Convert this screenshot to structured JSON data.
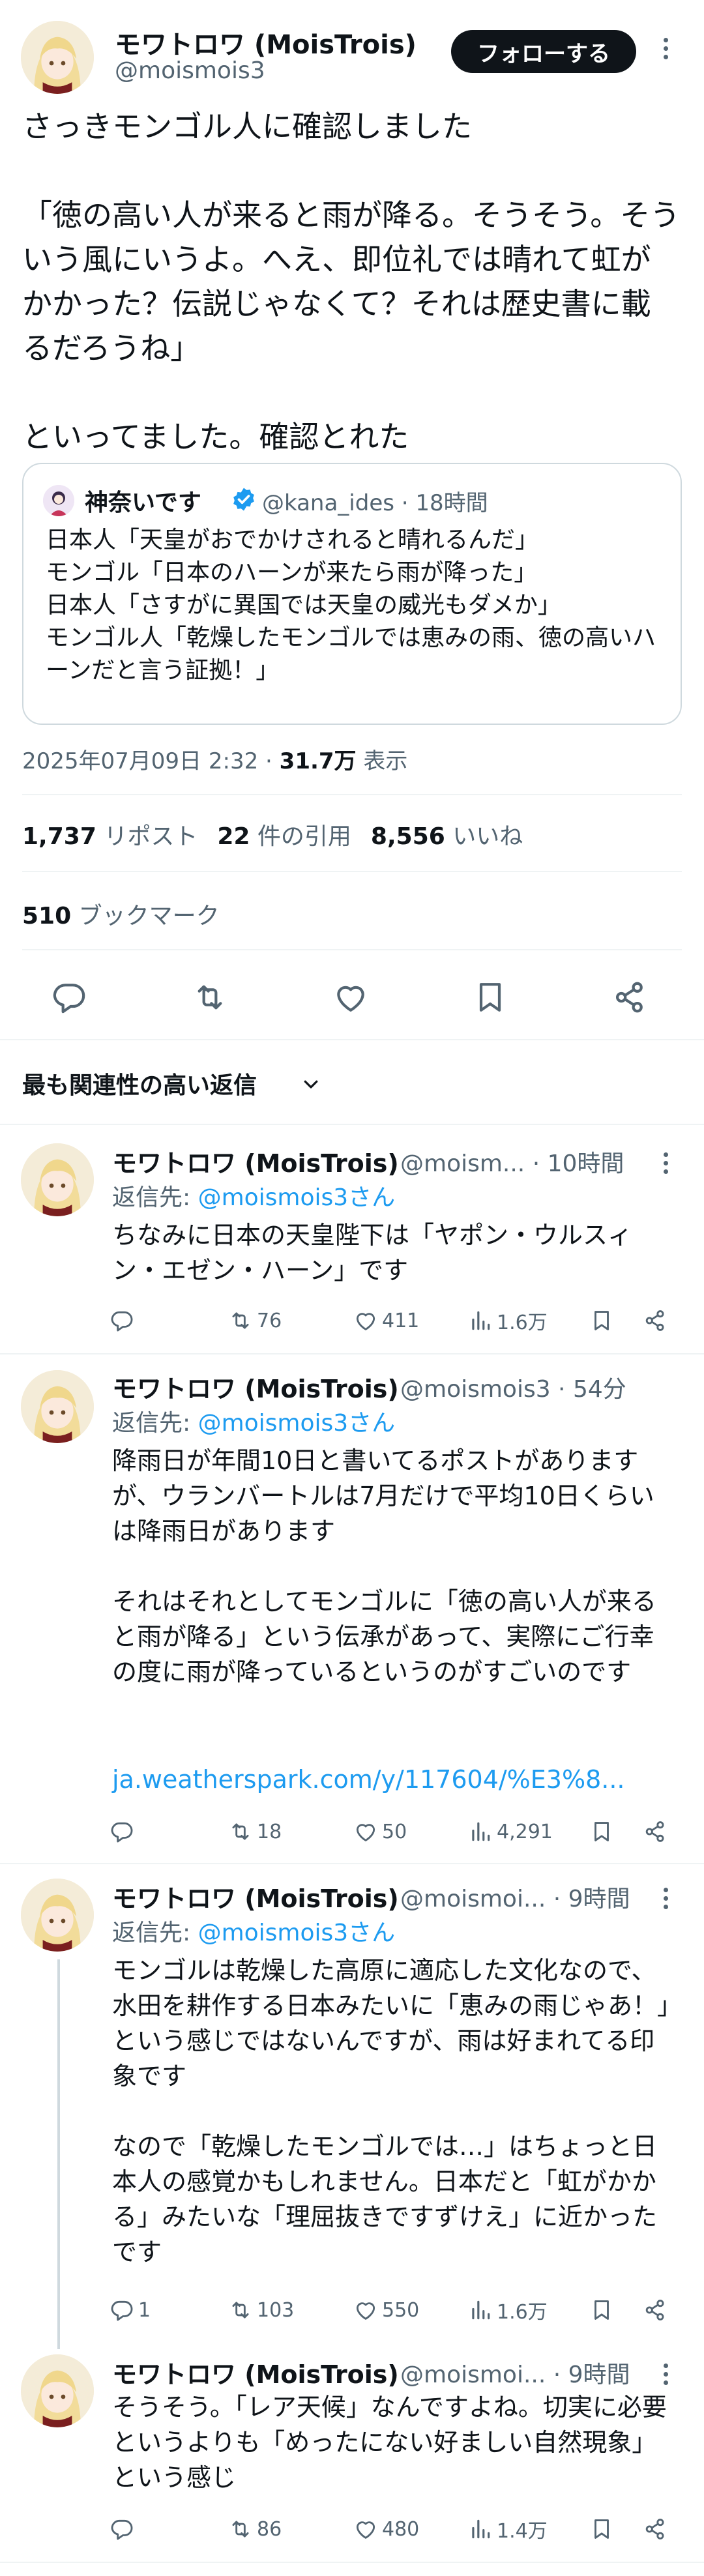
{
  "post": {
    "author_name": "モワトロワ (MoisTrois)",
    "author_handle": "@moismois3",
    "follow_label": "フォローする",
    "text": "さっきモンゴル人に確認しました\n\n「徳の高い人が来ると雨が降る。そうそう。そういう風にいうよ。へえ、即位礼では晴れて虹がかかった？伝説じゃなくて？それは歴史書に載るだろうね」\n\nといってました。確認とれた",
    "quote": {
      "author_name": "神奈いです",
      "author_handle": "@kana_ides",
      "time": "18時間",
      "text": "日本人「天皇がおでかけされると晴れるんだ」\nモンゴル「日本のハーンが来たら雨が降った」\n日本人「さすがに異国では天皇の威光もダメか」\nモンゴル人「乾燥したモンゴルでは恵みの雨、徳の高いハーンだと言う証拠！」"
    },
    "timestamp": "2025年07月09日 2:32",
    "views_count": "31.7万",
    "views_label": "表示",
    "reposts_count": "1,737",
    "reposts_label": "リポスト",
    "quotes_count": "22",
    "quotes_label": "件の引用",
    "likes_count": "8,556",
    "likes_label": "いいね",
    "bookmarks_count": "510",
    "bookmarks_label": "ブックマーク"
  },
  "replies_header": {
    "sort_label": "最も関連性の高い返信"
  },
  "replies": [
    {
      "author_name": "モワトロワ (MoisTrois)",
      "handle_time": "@moism... · 10時間",
      "reply_to_prefix": "返信先: ",
      "reply_to": "@moismois3さん",
      "text": "ちなみに日本の天皇陛下は「ヤポン・ウルスィン・エゼン・ハーン」です",
      "link": "",
      "retweets": "76",
      "likes": "411",
      "views": "1.6万"
    },
    {
      "author_name": "モワトロワ (MoisTrois)",
      "handle_time": "@moismois3 · 54分",
      "reply_to_prefix": "返信先: ",
      "reply_to": "@moismois3さん",
      "text": "降雨日が年間10日と書いてるポストがありますが、ウランバートルは7月だけで平均10日くらいは降雨日があります\n\nそれはそれとしてモンゴルに「徳の高い人が来ると雨が降る」という伝承があって、実際にご行幸の度に雨が降っているというのがすごいのです",
      "link": "ja.weatherspark.com/y/117604/%E3%8...",
      "retweets": "18",
      "likes": "50",
      "views": "4,291"
    },
    {
      "author_name": "モワトロワ (MoisTrois)",
      "handle_time": "@moismoi... · 9時間",
      "reply_to_prefix": "返信先: ",
      "reply_to": "@moismois3さん",
      "text": "モンゴルは乾燥した高原に適応した文化なので、水田を耕作する日本みたいに「恵みの雨じゃあ！」という感じではないんですが、雨は好まれてる印象です\n\nなので「乾燥したモンゴルでは…」はちょっと日本人の感覚かもしれません。日本だと「虹がかかる」みたいな「理屈抜きですずけえ」に近かったです",
      "link": "",
      "replies": "1",
      "retweets": "103",
      "likes": "550",
      "views": "1.6万"
    },
    {
      "author_name": "モワトロワ (MoisTrois)",
      "handle_time": "@moismoi... · 9時間",
      "text": "そうそう。「レア天候」なんですよね。切実に必要というよりも「めったにない好ましい自然現象」という感じ",
      "retweets": "86",
      "likes": "480",
      "views": "1.4万"
    }
  ],
  "icons": {
    "reply": "reply-icon",
    "retweet": "retweet-icon",
    "like": "heart-icon",
    "bookmark": "bookmark-icon",
    "share": "share-icon",
    "views": "views-icon",
    "verified": "verified-badge-icon"
  },
  "colors": {
    "accent": "#1d9bf0",
    "text": "#0f1419",
    "muted": "#536471",
    "border": "#eff3f4"
  }
}
